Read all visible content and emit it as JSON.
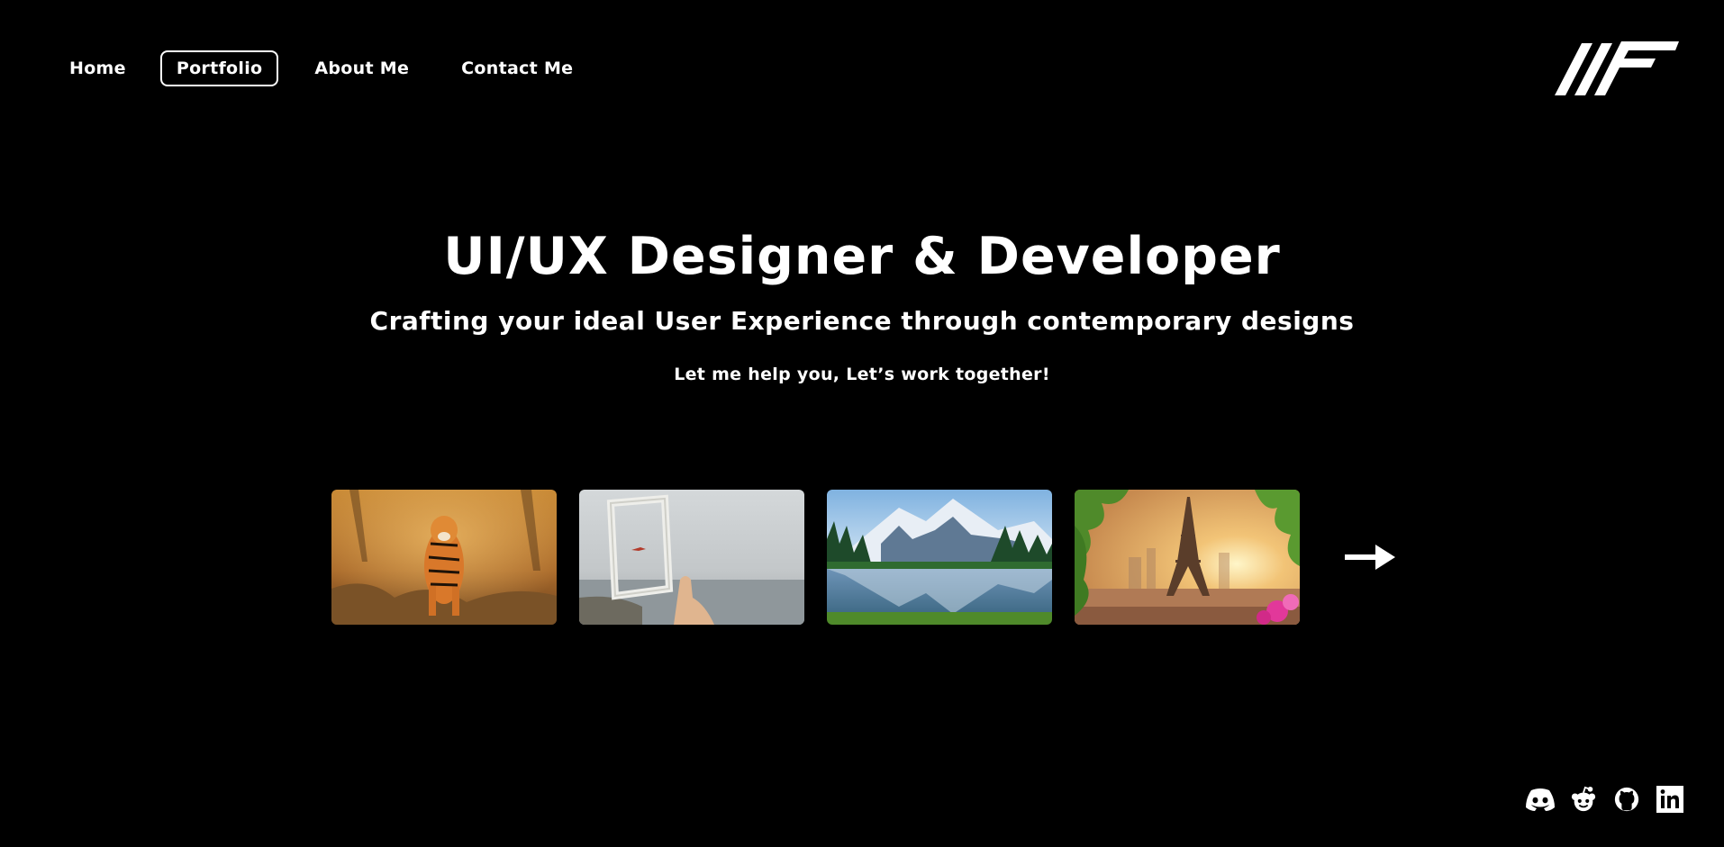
{
  "nav": {
    "items": [
      {
        "label": "Home",
        "active": false
      },
      {
        "label": "Portfolio",
        "active": true
      },
      {
        "label": "About Me",
        "active": false
      },
      {
        "label": "Contact Me",
        "active": false
      }
    ]
  },
  "logo": {
    "icon": "brand-logo-icon"
  },
  "hero": {
    "title": "UI/UX Designer & Developer",
    "subtitle": "Crafting your ideal User Experience through contemporary designs",
    "cta": "Let me help you, Let’s work together!"
  },
  "gallery": {
    "items": [
      {
        "icon": "tiger-image"
      },
      {
        "icon": "frame-seascape-image"
      },
      {
        "icon": "mountain-lake-image"
      },
      {
        "icon": "eiffel-tower-image"
      }
    ],
    "next_icon": "arrow-right-icon"
  },
  "social": {
    "icons": [
      "discord-icon",
      "reddit-icon",
      "github-icon",
      "linkedin-icon"
    ]
  },
  "colors": {
    "background": "#000000",
    "foreground": "#ffffff"
  }
}
